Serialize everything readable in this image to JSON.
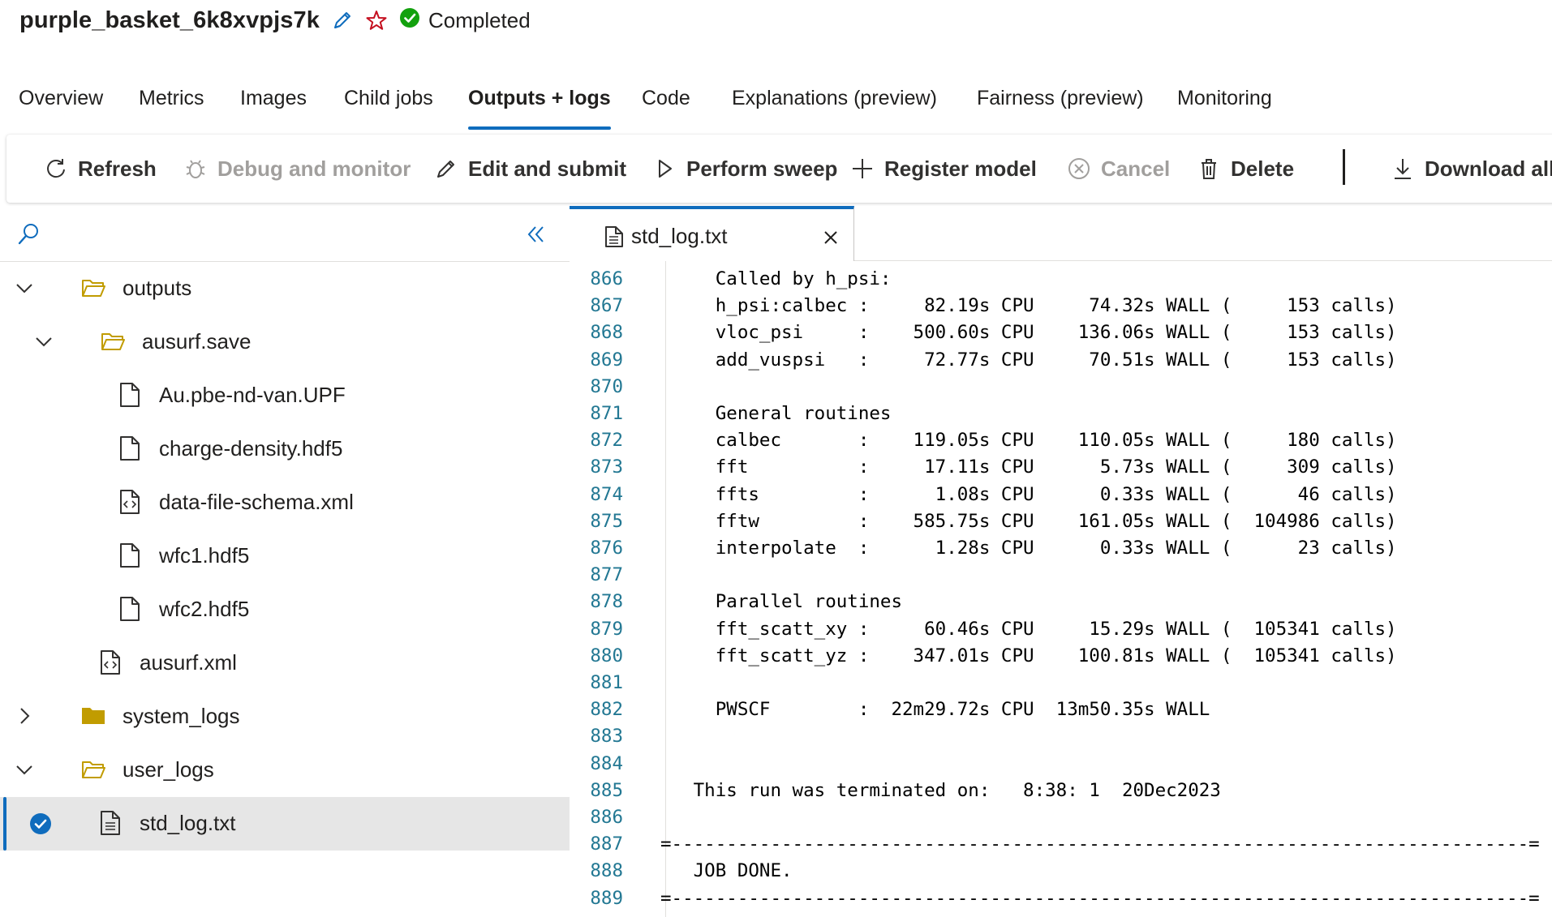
{
  "header": {
    "job_name": "purple_basket_6k8xvpjs7k",
    "status": "Completed",
    "edit_icon": "pencil-icon",
    "favorite_icon": "star-icon",
    "status_icon": "check-circle-icon",
    "colors": {
      "accent": "#0f6cbd",
      "success": "#13a10e",
      "favorite": "#c50f1f"
    }
  },
  "tabs": [
    {
      "label": "Overview"
    },
    {
      "label": "Metrics"
    },
    {
      "label": "Images"
    },
    {
      "label": "Child jobs"
    },
    {
      "label": "Outputs + logs",
      "active": true
    },
    {
      "label": "Code"
    },
    {
      "label": "Explanations (preview)"
    },
    {
      "label": "Fairness (preview)"
    },
    {
      "label": "Monitoring"
    }
  ],
  "toolbar": {
    "refresh": "Refresh",
    "debug": "Debug and monitor",
    "edit_submit": "Edit and submit",
    "sweep": "Perform sweep",
    "register": "Register model",
    "cancel": "Cancel",
    "delete": "Delete",
    "download": "Download all"
  },
  "file_tree": {
    "search_icon": "search-icon",
    "collapse_icon": "double-chevron-left-icon",
    "items": [
      {
        "label": "outputs",
        "type": "folder",
        "expanded": true
      },
      {
        "label": "ausurf.save",
        "type": "folder",
        "expanded": true
      },
      {
        "label": "Au.pbe-nd-van.UPF",
        "type": "file"
      },
      {
        "label": "charge-density.hdf5",
        "type": "file"
      },
      {
        "label": "data-file-schema.xml",
        "type": "code-file"
      },
      {
        "label": "wfc1.hdf5",
        "type": "file"
      },
      {
        "label": "wfc2.hdf5",
        "type": "file"
      },
      {
        "label": "ausurf.xml",
        "type": "code-file"
      },
      {
        "label": "system_logs",
        "type": "folder",
        "expanded": false
      },
      {
        "label": "user_logs",
        "type": "folder",
        "expanded": true
      },
      {
        "label": "std_log.txt",
        "type": "text-file",
        "selected": true
      }
    ]
  },
  "editor": {
    "open_file": "std_log.txt",
    "close_icon": "close-icon",
    "partial_top_line": "865",
    "lines": [
      {
        "n": "866",
        "text": "     Called by h_psi:"
      },
      {
        "n": "867",
        "text": "     h_psi:calbec :     82.19s CPU     74.32s WALL (     153 calls)"
      },
      {
        "n": "868",
        "text": "     vloc_psi     :    500.60s CPU    136.06s WALL (     153 calls)"
      },
      {
        "n": "869",
        "text": "     add_vuspsi   :     72.77s CPU     70.51s WALL (     153 calls)"
      },
      {
        "n": "870",
        "text": ""
      },
      {
        "n": "871",
        "text": "     General routines"
      },
      {
        "n": "872",
        "text": "     calbec       :    119.05s CPU    110.05s WALL (     180 calls)"
      },
      {
        "n": "873",
        "text": "     fft          :     17.11s CPU      5.73s WALL (     309 calls)"
      },
      {
        "n": "874",
        "text": "     ffts         :      1.08s CPU      0.33s WALL (      46 calls)"
      },
      {
        "n": "875",
        "text": "     fftw         :    585.75s CPU    161.05s WALL (  104986 calls)"
      },
      {
        "n": "876",
        "text": "     interpolate  :      1.28s CPU      0.33s WALL (      23 calls)"
      },
      {
        "n": "877",
        "text": ""
      },
      {
        "n": "878",
        "text": "     Parallel routines"
      },
      {
        "n": "879",
        "text": "     fft_scatt_xy :     60.46s CPU     15.29s WALL (  105341 calls)"
      },
      {
        "n": "880",
        "text": "     fft_scatt_yz :    347.01s CPU    100.81s WALL (  105341 calls)"
      },
      {
        "n": "881",
        "text": ""
      },
      {
        "n": "882",
        "text": "     PWSCF        :  22m29.72s CPU  13m50.35s WALL"
      },
      {
        "n": "883",
        "text": ""
      },
      {
        "n": "884",
        "text": ""
      },
      {
        "n": "885",
        "text": "   This run was terminated on:   8:38: 1  20Dec2023"
      },
      {
        "n": "886",
        "text": ""
      },
      {
        "n": "887",
        "text": "=------------------------------------------------------------------------------="
      },
      {
        "n": "888",
        "text": "   JOB DONE."
      },
      {
        "n": "889",
        "text": "=------------------------------------------------------------------------------="
      }
    ]
  }
}
